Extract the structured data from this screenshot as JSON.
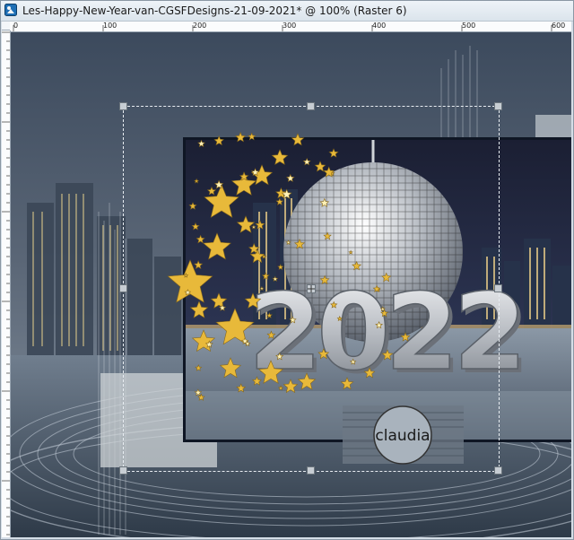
{
  "window": {
    "title": "Les-Happy-New-Year-van-CGSFDesigns-21-09-2021* @ 100% (Raster 6)"
  },
  "ruler": {
    "labels": [
      "0",
      "100",
      "200",
      "300",
      "400",
      "500",
      "600"
    ]
  },
  "artwork": {
    "year_text": "2022",
    "watermark": "claudia"
  },
  "colors": {
    "sky": "#1c2436",
    "water": "#5f6e80",
    "gold": "#e8b93a",
    "silver": "#c9ccd0",
    "title_bar": "#dbe4ec"
  },
  "icons": {
    "app": "paintshop-pro-icon",
    "handle": "transform-handle",
    "pivot": "pivot-point-icon"
  }
}
